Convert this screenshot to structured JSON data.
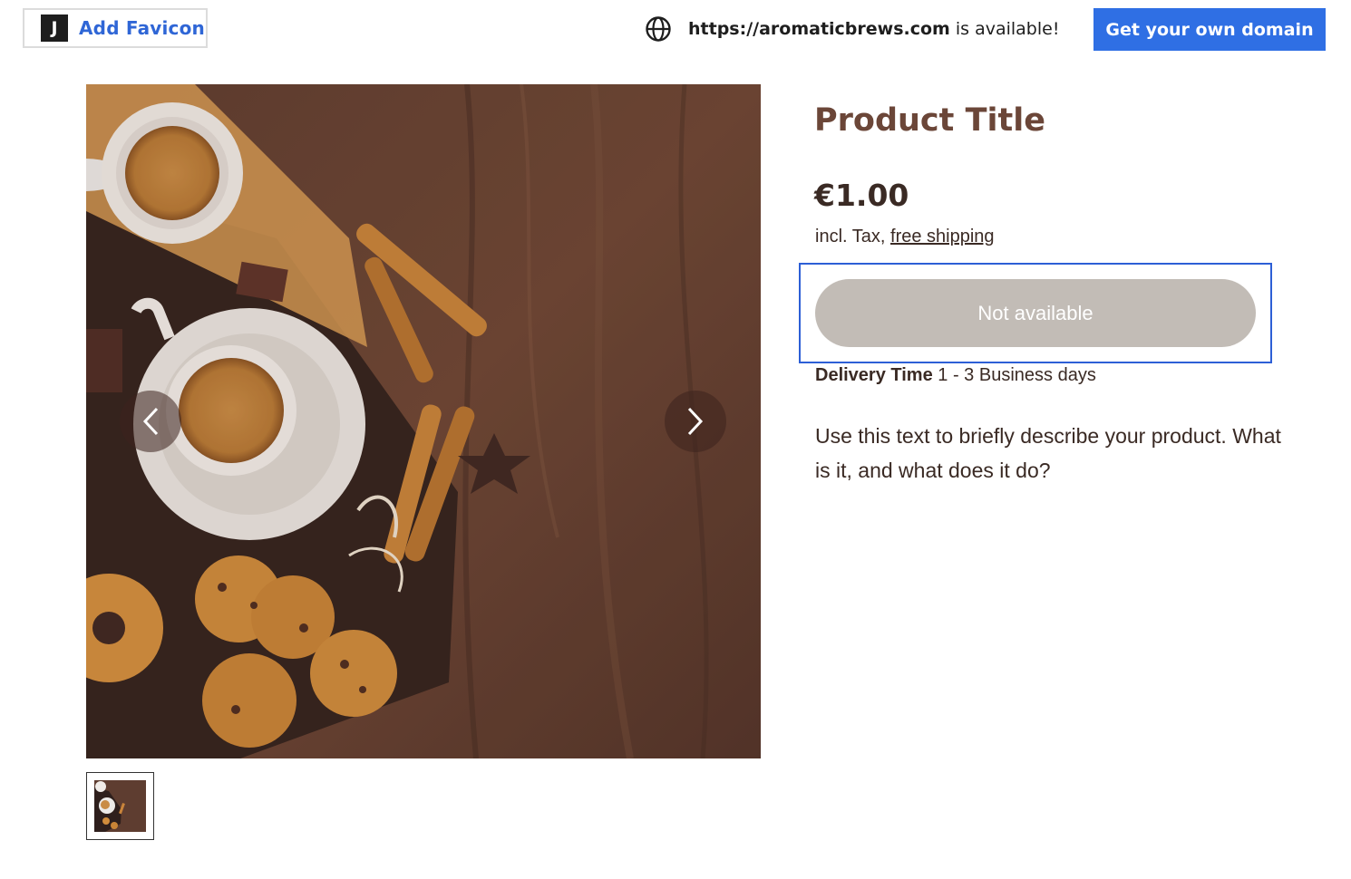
{
  "topbar": {
    "favicon": {
      "letter": "J",
      "label": "Add Favicon"
    },
    "domain": {
      "url": "https://aromaticbrews.com",
      "suffix": "is available!",
      "icon": "globe-icon"
    },
    "cta_label": "Get your own domain"
  },
  "gallery": {
    "prev_icon": "chevron-left-icon",
    "next_icon": "chevron-right-icon",
    "thumbnail_count": 1
  },
  "product": {
    "title": "Product Title",
    "price": "€1.00",
    "tax_prefix": "incl. Tax,",
    "shipping_link": "free shipping",
    "button_label": "Not available",
    "delivery_label": "Delivery Time",
    "delivery_value": "1 - 3 Business days",
    "description": "Use this text to briefly describe your product. What is it, and what does it do?"
  },
  "colors": {
    "accent": "#2f6fe4",
    "title": "#6b4638",
    "text": "#3a2a24",
    "disabled_button": "#c2bcb6",
    "focus_outline": "#2d5fd6"
  }
}
